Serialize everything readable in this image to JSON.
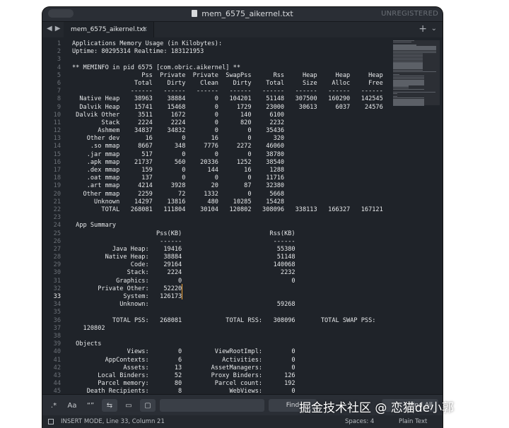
{
  "window": {
    "title": "mem_6575_aikernel.txt",
    "registration_status": "UNREGISTERED"
  },
  "tabs": [
    {
      "label": "mem_6575_aikernel.txt",
      "close": "×"
    }
  ],
  "tabbar": {
    "back": "◀",
    "forward": "▶",
    "new_tab": "+",
    "overflow": "⌄"
  },
  "editor": {
    "current_line": 33,
    "lines": [
      "Applications Memory Usage (in Kilobytes):",
      "Uptime: 80295314 Realtime: 183121953",
      "",
      "** MEMINFO in pid 6575 [com.obric.aikernel] **",
      "                   Pss  Private  Private  SwapPss      Rss     Heap     Heap     Heap",
      "                 Total    Dirty    Clean    Dirty    Total     Size    Alloc     Free",
      "                ------   ------   ------   ------   ------   ------   ------   ------",
      "  Native Heap    38963    38884        0   104201    51148   307500   160290   142545",
      "  Dalvik Heap    15741    15468        0     1729    23000    30613     6037    24576",
      " Dalvik Other     3511     1672        0      140     6100",
      "        Stack     2224     2224        0      820     2232",
      "       Ashmem    34837    34832        0        0    35436",
      "    Other dev       16        0       16        0      320",
      "     .so mmap     8667      348     7776     2272    46060",
      "    .jar mmap      517        0        0        0    38780",
      "    .apk mmap    21737      560    20336     1252    38540",
      "    .dex mmap      159        0      144       16     1288",
      "    .oat mmap      137        0        0        0    11716",
      "    .art mmap     4214     3928       20       87    32380",
      "   Other mmap     2259       72     1332        0     5668",
      "      Unknown    14297    13816      480    10285    15428",
      "        TOTAL   268081   111804    30104   120802   308096   338113   166327   167121",
      "",
      " App Summary",
      "                       Pss(KB)                        Rss(KB)",
      "                        ------                         ------",
      "           Java Heap:    19416                          55380",
      "         Native Heap:    38884                          51148",
      "                Code:    29164                         140068",
      "               Stack:     2224                           2232",
      "            Graphics:        0                              0",
      "       Private Other:    52220",
      "              System:   126173",
      "             Unknown:                                   59268",
      "",
      "           TOTAL PSS:   268081            TOTAL RSS:   308096       TOTAL SWAP PSS:",
      "   120802",
      "",
      " Objects",
      "               Views:        0         ViewRootImpl:        0",
      "         AppContexts:        6           Activities:        0",
      "              Assets:       13        AssetManagers:        0",
      "       Local Binders:       52        Proxy Binders:      126",
      "       Parcel memory:       80         Parcel count:      192",
      "    Death Recipients:        8             WebViews:        0",
      ""
    ]
  },
  "findbar": {
    "regex_icon": ".*",
    "case_label": "Aa",
    "whole_word_label": "“”",
    "find_label": "Find",
    "find_all_label": "Find All"
  },
  "statusbar": {
    "mode": "INSERT MODE, Line 33, Column 21",
    "spaces": "Spaces: 4",
    "syntax": "Plain Text"
  },
  "watermark": "掘金技术社区 @ 恋猫de小郭",
  "colors": {
    "editor_bg": "#1f2329",
    "cursor": "#f0a33a",
    "text": "#e6e8ea"
  }
}
